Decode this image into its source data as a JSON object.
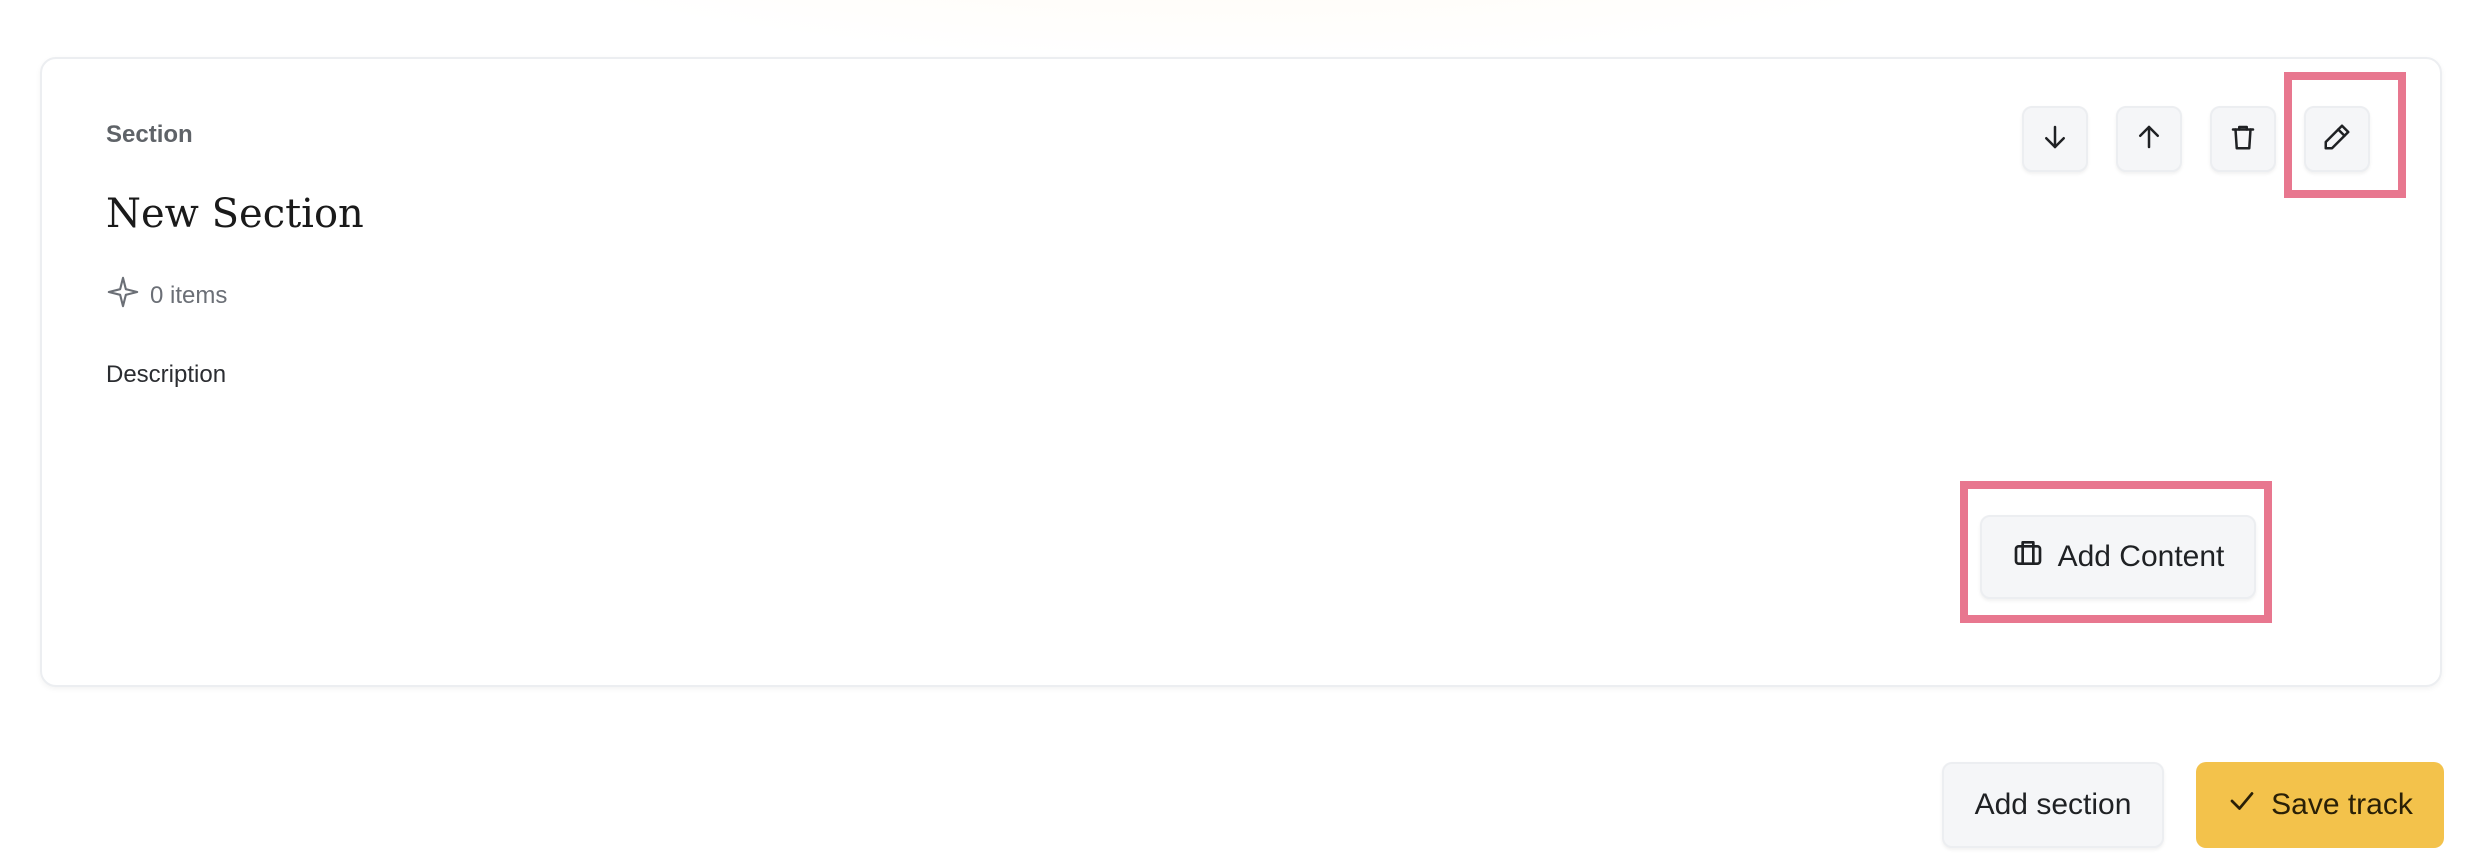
{
  "card": {
    "eyebrow": "Section",
    "title": "New Section",
    "item_count": "0 items",
    "description_label": "Description"
  },
  "actions": {
    "move_down_icon": "arrow-down-icon",
    "move_up_icon": "arrow-up-icon",
    "delete_icon": "trash-icon",
    "edit_icon": "pencil-icon",
    "add_content_label": "Add Content",
    "add_content_icon": "briefcase-icon"
  },
  "footer": {
    "add_section_label": "Add section",
    "save_track_label": "Save track",
    "save_icon": "check-icon"
  },
  "colors": {
    "highlight": "#e8778f",
    "save_button": "#f3c24b",
    "button_bg": "#f5f6f8",
    "card_border": "#eceef1"
  }
}
